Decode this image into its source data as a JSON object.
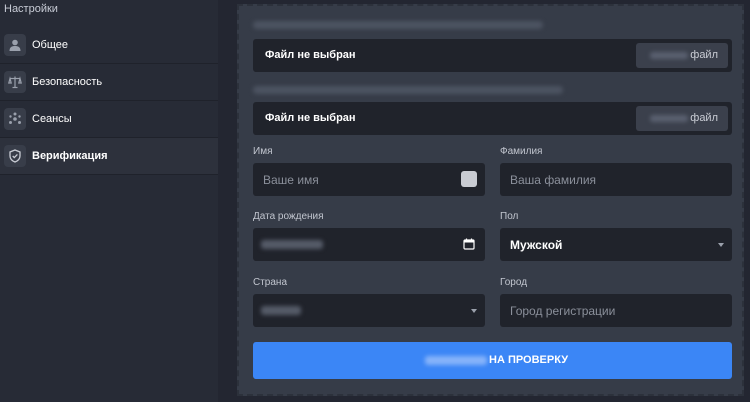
{
  "sidebar": {
    "title": "Настройки",
    "items": [
      {
        "label": "Общее",
        "icon": "user-icon"
      },
      {
        "label": "Безопасность",
        "icon": "scales-icon"
      },
      {
        "label": "Сеансы",
        "icon": "sessions-icon"
      },
      {
        "label": "Верификация",
        "icon": "shield-icon",
        "active": true
      }
    ]
  },
  "form": {
    "file_rows": [
      {
        "status": "Файл не выбран",
        "button_suffix": "файл"
      },
      {
        "status": "Файл не выбран",
        "button_suffix": "файл"
      }
    ],
    "first_name": {
      "label": "Имя",
      "placeholder": "Ваше имя"
    },
    "last_name": {
      "label": "Фамилия",
      "placeholder": "Ваша фамилия"
    },
    "birth_date": {
      "label": "Дата рождения"
    },
    "gender": {
      "label": "Пол",
      "value": "Мужской"
    },
    "country": {
      "label": "Страна"
    },
    "city": {
      "label": "Город",
      "placeholder": "Город регистрации"
    },
    "submit_suffix": "НА ПРОВЕРКУ"
  },
  "colors": {
    "accent": "#3b86f6",
    "background": "#232631",
    "panel": "#363c48",
    "input": "#20232b"
  }
}
